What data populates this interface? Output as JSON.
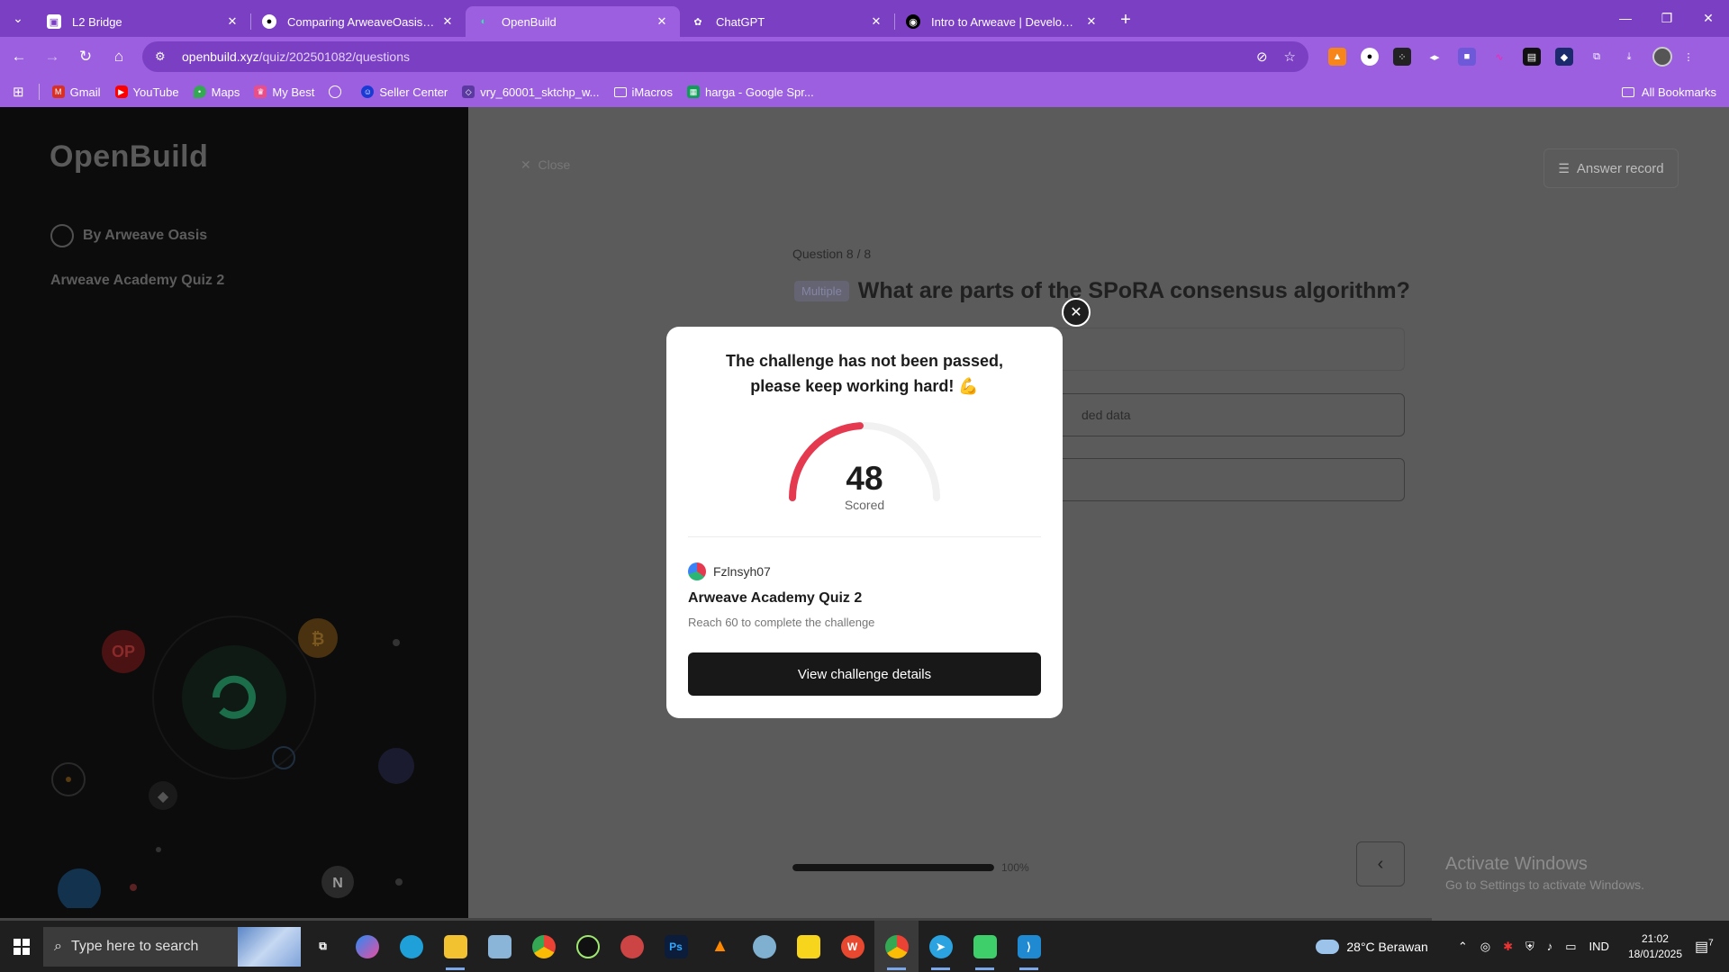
{
  "browser": {
    "tabs": [
      {
        "title": "L2 Bridge",
        "active": false
      },
      {
        "title": "Comparing ArweaveOasis:main",
        "active": false
      },
      {
        "title": "OpenBuild",
        "active": true
      },
      {
        "title": "ChatGPT",
        "active": false
      },
      {
        "title": "Intro to Arweave | Developer D",
        "active": false
      }
    ],
    "url_host": "openbuild.xyz",
    "url_path": "/quiz/202501082/questions",
    "bookmarks": [
      "Gmail",
      "YouTube",
      "Maps",
      "My Best",
      "Seller Center",
      "vry_60001_sktchp_w...",
      "iMacros",
      "harga - Google Spr..."
    ],
    "all_bookmarks": "All Bookmarks"
  },
  "sidebar": {
    "logo": "OpenBuild",
    "byline": "By Arweave Oasis",
    "quiz_name": "Arweave Academy Quiz 2"
  },
  "quiz": {
    "close": "Close",
    "answer_record": "Answer record",
    "question_counter": "Question 8 / 8",
    "question_type": "Multiple",
    "question_title": "What are parts of the SPoRA consensus algorithm?",
    "option_partial": "ded data",
    "progress_percent": 100,
    "progress_label": "100%",
    "prev_icon": "chevron-left-icon"
  },
  "modal": {
    "heading_line1": "The challenge has not been passed,",
    "heading_line2": "please keep working hard! 💪",
    "score": "48",
    "score_value": 48,
    "score_label": "Scored",
    "username": "Fzlnsyh07",
    "challenge_title": "Arweave Academy Quiz 2",
    "requirement": "Reach 60 to complete the challenge",
    "button": "View challenge details",
    "gauge_color": "#e53950"
  },
  "watermark": {
    "line1": "Activate Windows",
    "line2": "Go to Settings to activate Windows."
  },
  "taskbar": {
    "search_placeholder": "Type here to search",
    "weather": "28°C Berawan",
    "language": "IND",
    "time": "21:02",
    "date": "18/01/2025",
    "notification_count": "7"
  }
}
